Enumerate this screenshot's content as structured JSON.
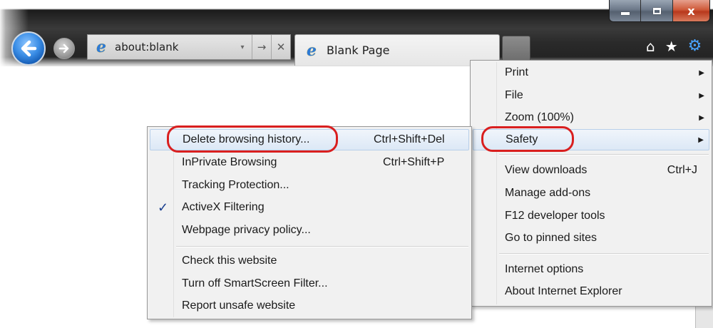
{
  "window": {
    "minimize_icon": "minimize-icon",
    "maximize_icon": "maximize-icon",
    "close_label": "x"
  },
  "nav": {
    "back_icon": "back-arrow-icon",
    "forward_icon": "forward-arrow-icon"
  },
  "address_bar": {
    "value": "about:blank",
    "dropdown_glyph": "▾",
    "go_glyph": "→",
    "stop_glyph": "✕"
  },
  "tab": {
    "title": "Blank Page"
  },
  "command_icons": {
    "home": "⌂",
    "favorites": "★",
    "tools": "⚙"
  },
  "tools_menu": {
    "items": [
      {
        "label": "Print",
        "arrow": "▶"
      },
      {
        "label": "File",
        "arrow": "▶"
      },
      {
        "label": "Zoom (100%)",
        "arrow": "▶"
      },
      {
        "label": "Safety",
        "arrow": "▶",
        "highlighted": true
      },
      {
        "label": "View downloads",
        "shortcut": "Ctrl+J"
      },
      {
        "label": "Manage add-ons"
      },
      {
        "label": "F12 developer tools"
      },
      {
        "label": "Go to pinned sites"
      },
      {
        "label": "Internet options"
      },
      {
        "label": "About Internet Explorer"
      }
    ]
  },
  "safety_menu": {
    "items": [
      {
        "label": "Delete browsing history...",
        "shortcut": "Ctrl+Shift+Del",
        "highlighted": true
      },
      {
        "label": "InPrivate Browsing",
        "shortcut": "Ctrl+Shift+P"
      },
      {
        "label": "Tracking Protection..."
      },
      {
        "label": "ActiveX Filtering",
        "checked": true,
        "check_glyph": "✓"
      },
      {
        "label": "Webpage privacy policy..."
      },
      {
        "label": "Check this website"
      },
      {
        "label": "Turn off SmartScreen Filter..."
      },
      {
        "label": "Report unsafe website"
      }
    ]
  },
  "colors": {
    "annotation_ring": "#d91f1f",
    "menu_background": "#f1f1f1",
    "highlight": "#dce8f6",
    "accent_blue": "#3b8ee6"
  }
}
